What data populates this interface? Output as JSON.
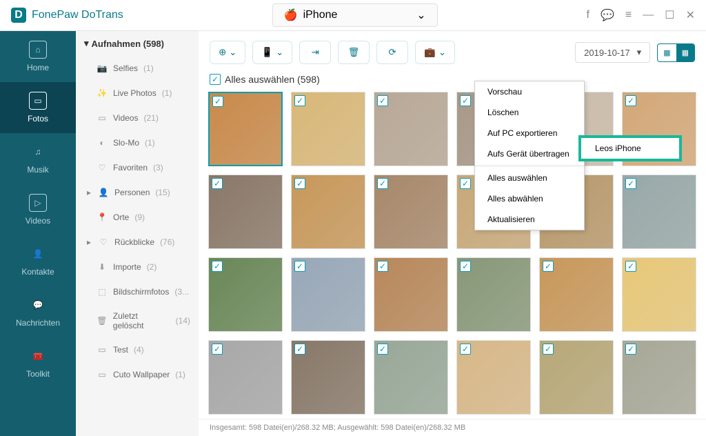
{
  "app": {
    "name": "FonePaw DoTrans"
  },
  "device": {
    "label": "iPhone"
  },
  "nav": {
    "home": "Home",
    "photos": "Fotos",
    "music": "Musik",
    "videos": "Videos",
    "contacts": "Kontakte",
    "messages": "Nachrichten",
    "toolkit": "Toolkit"
  },
  "sidebar": {
    "header": "Aufnahmen (598)",
    "items": [
      {
        "label": "Selfies",
        "count": "(1)"
      },
      {
        "label": "Live Photos",
        "count": "(1)"
      },
      {
        "label": "Videos",
        "count": "(21)"
      },
      {
        "label": "Slo-Mo",
        "count": "(1)"
      },
      {
        "label": "Favoriten",
        "count": "(3)"
      },
      {
        "label": "Personen",
        "count": "(15)",
        "expandable": true
      },
      {
        "label": "Orte",
        "count": "(9)"
      },
      {
        "label": "Rückblicke",
        "count": "(76)",
        "expandable": true
      },
      {
        "label": "Importe",
        "count": "(2)"
      },
      {
        "label": "Bildschirmfotos",
        "count": "(3..."
      },
      {
        "label": "Zuletzt gelöscht",
        "count": "(14)"
      },
      {
        "label": "Test",
        "count": "(4)"
      },
      {
        "label": "Cuto Wallpaper",
        "count": "(1)"
      }
    ]
  },
  "toolbar": {
    "date": "2019-10-17"
  },
  "selectAll": {
    "label": "Alles auswählen (598)"
  },
  "context": {
    "preview": "Vorschau",
    "delete": "Löschen",
    "export": "Auf PC exportieren",
    "transfer": "Aufs Gerät übertragen",
    "selectAll": "Alles auswählen",
    "deselectAll": "Alles abwählen",
    "refresh": "Aktualisieren",
    "submenu": "Leos iPhone"
  },
  "status": "Insgesamt: 598 Datei(en)/268.32 MB; Ausgewählt: 598 Datei(en)/268.32 MB",
  "thumbColors": [
    "#c98a4a",
    "#d9b878",
    "#b8a896",
    "#a89888",
    "#cbbba8",
    "#d4a878",
    "#8a7868",
    "#c8985a",
    "#a8886a",
    "#c8a878",
    "#b8986a",
    "#98a8a8",
    "#6a8858",
    "#98a8b8",
    "#b8885a",
    "#889878",
    "#c8985a",
    "#e8c878",
    "#a8a8a8",
    "#887868",
    "#98a898",
    "#d8b888",
    "#b8a878",
    "#a8a898"
  ]
}
